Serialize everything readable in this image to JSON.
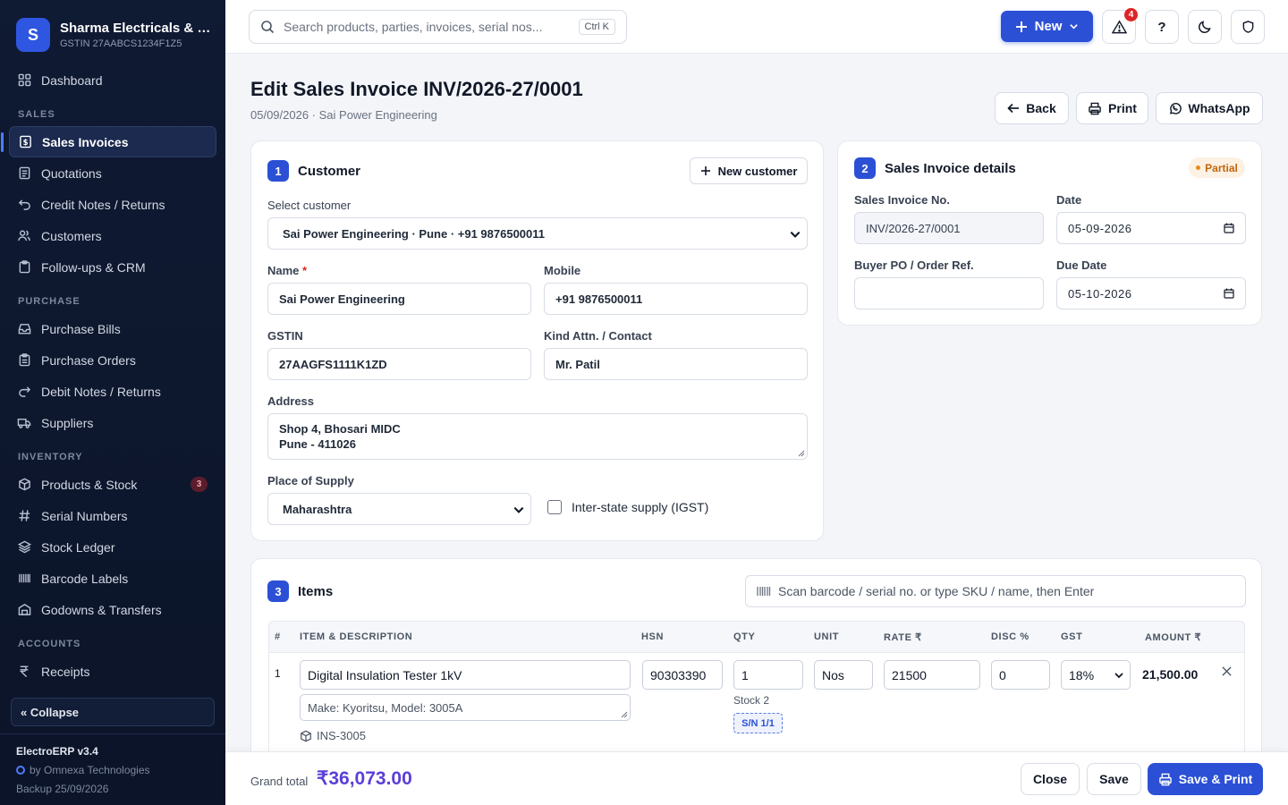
{
  "brand": {
    "initial": "S",
    "name": "Sharma Electricals & Services",
    "gstin": "GSTIN 27AABCS1234F1Z5"
  },
  "sidebar": {
    "dashboard": "Dashboard",
    "sections": [
      "SALES",
      "PURCHASE",
      "INVENTORY",
      "ACCOUNTS"
    ],
    "sales": [
      "Sales Invoices",
      "Quotations",
      "Credit Notes / Returns",
      "Customers",
      "Follow-ups & CRM"
    ],
    "purchase": [
      "Purchase Bills",
      "Purchase Orders",
      "Debit Notes / Returns",
      "Suppliers"
    ],
    "inventory": [
      "Products & Stock",
      "Serial Numbers",
      "Stock Ledger",
      "Barcode Labels",
      "Godowns & Transfers"
    ],
    "inventory_badge": "3",
    "accounts": [
      "Receipts"
    ],
    "collapse": "« Collapse",
    "version": "ElectroERP v3.4",
    "vendor": "by Omnexa Technologies",
    "backup": "Backup 25/09/2026"
  },
  "topbar": {
    "search_placeholder": "Search products, parties, invoices, serial nos...",
    "shortcut": "Ctrl K",
    "new_label": "New",
    "alerts_count": "4",
    "help": "?"
  },
  "header": {
    "title": "Edit Sales Invoice INV/2026-27/0001",
    "subtitle": "05/09/2026 · Sai Power Engineering",
    "back": "Back",
    "print": "Print",
    "whatsapp": "WhatsApp"
  },
  "customer": {
    "step": "1",
    "title": "Customer",
    "new_customer": "New customer",
    "select_label": "Select customer",
    "select_value": "Sai Power Engineering · Pune · +91 9876500011",
    "name_label": "Name",
    "name_req": "*",
    "name": "Sai Power Engineering",
    "mobile_label": "Mobile",
    "mobile": "+91 9876500011",
    "gstin_label": "GSTIN",
    "gstin": "27AAGFS1111K1ZD",
    "contact_label": "Kind Attn. / Contact",
    "contact": "Mr. Patil",
    "address_label": "Address",
    "address_line1": "Shop 4, Bhosari MIDC",
    "address_line2": "Pune - 411026",
    "pos_label": "Place of Supply",
    "pos": "Maharashtra",
    "igst_label": "Inter-state supply (IGST)"
  },
  "details": {
    "step": "2",
    "title": "Sales Invoice details",
    "status": "Partial",
    "no_label": "Sales Invoice No.",
    "no": "INV/2026-27/0001",
    "date_label": "Date",
    "date": "05-09-2026",
    "po_label": "Buyer PO / Order Ref.",
    "po": "",
    "due_label": "Due Date",
    "due": "05-10-2026"
  },
  "items": {
    "step": "3",
    "title": "Items",
    "scan_placeholder": "Scan barcode / serial no. or type SKU / name, then Enter",
    "columns": [
      "#",
      "ITEM & DESCRIPTION",
      "HSN",
      "QTY",
      "UNIT",
      "RATE ₹",
      "DISC %",
      "GST",
      "AMOUNT ₹"
    ],
    "rows": [
      {
        "n": "1",
        "name": "Digital Insulation Tester 1kV",
        "desc": "Make: Kyoritsu, Model: 3005A",
        "sku": "INS-3005",
        "hsn": "90303390",
        "qty": "1",
        "unit": "Nos",
        "rate": "21500",
        "disc": "0",
        "gst": "18%",
        "amount": "21,500.00",
        "stock": "Stock 2",
        "serial": "S/N 1/1"
      }
    ]
  },
  "footer": {
    "grand_label": "Grand total",
    "grand_value": "₹36,073.00",
    "close": "Close",
    "save": "Save",
    "save_print": "Save & Print"
  },
  "colors": {
    "accent": "#2b50d6",
    "sidebar": "#0f1a33",
    "partial": "#c2650a"
  }
}
